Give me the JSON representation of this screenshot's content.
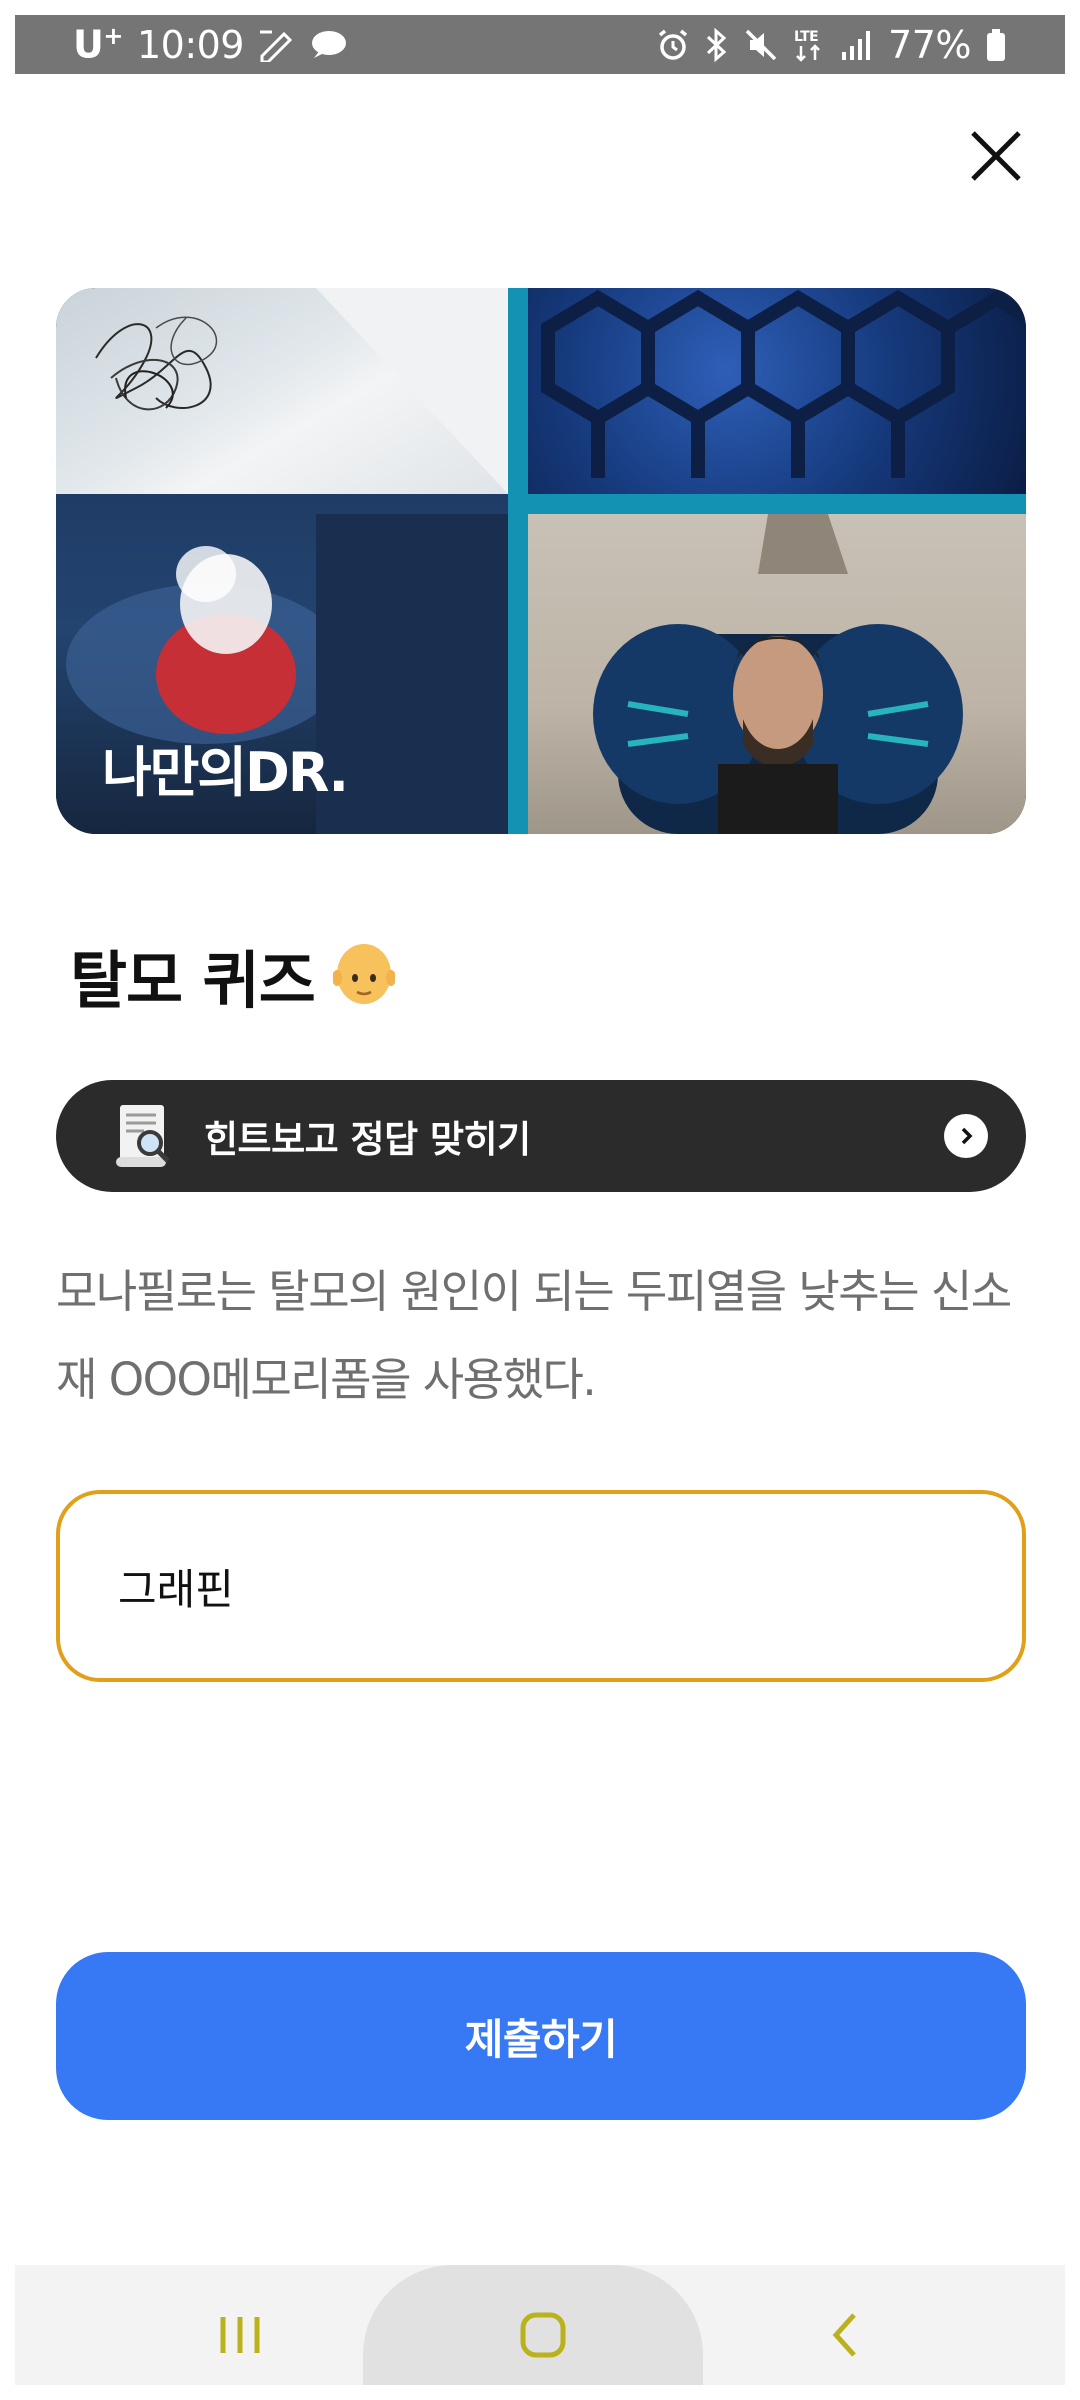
{
  "status_bar": {
    "carrier": "U",
    "carrier_sup": "+",
    "time": "10:09",
    "battery": "77%"
  },
  "hero": {
    "logo_text": "나만의DR."
  },
  "quiz": {
    "title": "탈모 퀴즈",
    "title_emoji": "bald-person"
  },
  "hint": {
    "label": "힌트보고 정답 맞히기"
  },
  "question": {
    "text": "모나필로는 탈모의 원인이 되는 두피열을 낮추는 신소재 OOO메모리폼을 사용했다."
  },
  "answer": {
    "value": "그래핀"
  },
  "submit": {
    "label": "제출하기"
  },
  "colors": {
    "submit": "#3778f4",
    "input_border": "#e1a01a",
    "hint_bar": "#2b2b2b",
    "status_bar": "#757575",
    "nav_icon": "#b9b21c"
  }
}
